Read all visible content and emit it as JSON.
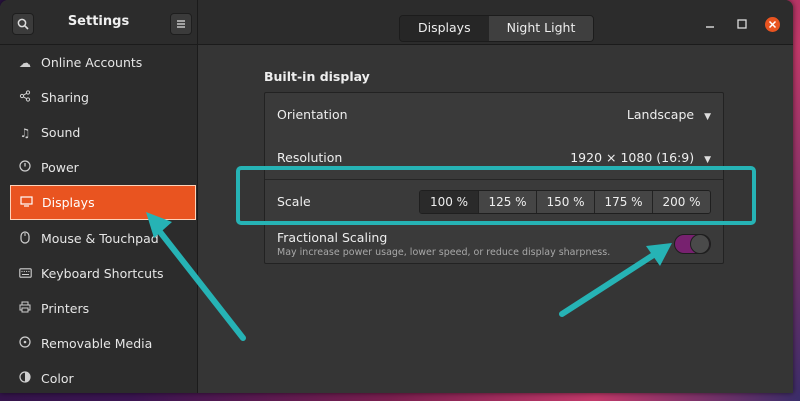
{
  "header": {
    "title": "Settings",
    "tabs": [
      "Displays",
      "Night Light"
    ]
  },
  "sidebar": {
    "items": [
      {
        "label": "Online Accounts",
        "icon": "cloud-icon"
      },
      {
        "label": "Sharing",
        "icon": "share-icon"
      },
      {
        "label": "Sound",
        "icon": "music-note-icon"
      },
      {
        "label": "Power",
        "icon": "power-icon"
      },
      {
        "label": "Displays",
        "icon": "display-icon",
        "active": true
      },
      {
        "label": "Mouse & Touchpad",
        "icon": "mouse-icon"
      },
      {
        "label": "Keyboard Shortcuts",
        "icon": "keyboard-icon"
      },
      {
        "label": "Printers",
        "icon": "printer-icon"
      },
      {
        "label": "Removable Media",
        "icon": "media-icon"
      },
      {
        "label": "Color",
        "icon": "color-icon"
      }
    ]
  },
  "main": {
    "section_title": "Built-in display",
    "orientation": {
      "label": "Orientation",
      "value": "Landscape"
    },
    "resolution": {
      "label": "Resolution",
      "value": "1920 × 1080 (16:9)"
    },
    "scale": {
      "label": "Scale",
      "options": [
        "100 %",
        "125 %",
        "150 %",
        "175 %",
        "200 %"
      ],
      "selected": "100 %"
    },
    "fractional_scaling": {
      "label": "Fractional Scaling",
      "description": "May increase power usage, lower speed, or reduce display sharpness.",
      "enabled": true
    }
  },
  "colors": {
    "accent": "#e95420",
    "toggle_on": "#77216f",
    "annotation": "#26b3b5"
  }
}
